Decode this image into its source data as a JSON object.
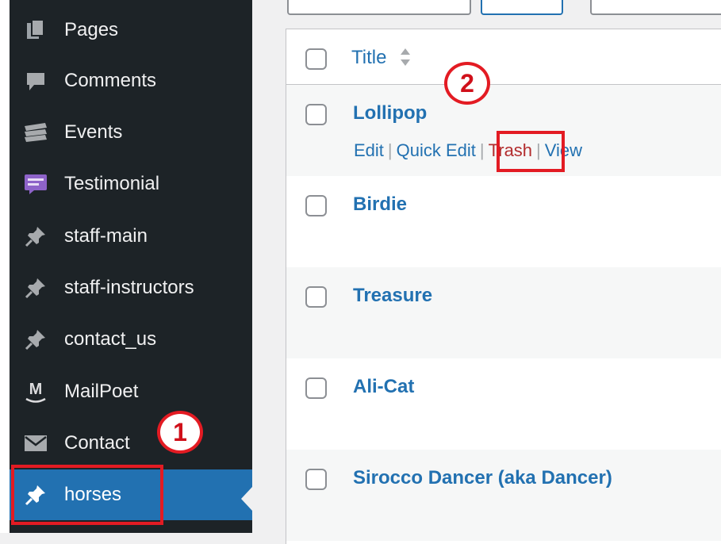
{
  "sidebar": {
    "items": [
      {
        "label": "Pages",
        "icon": "pages-icon"
      },
      {
        "label": "Comments",
        "icon": "comments-icon"
      },
      {
        "label": "Events",
        "icon": "events-icon"
      },
      {
        "label": "Testimonial",
        "icon": "testimonial-icon"
      },
      {
        "label": "staff-main",
        "icon": "pin-icon"
      },
      {
        "label": "staff-instructors",
        "icon": "pin-icon"
      },
      {
        "label": "contact_us",
        "icon": "pin-icon"
      },
      {
        "label": "MailPoet",
        "icon": "mailpoet-icon"
      },
      {
        "label": "Contact",
        "icon": "envelope-icon"
      },
      {
        "label": "horses",
        "icon": "pin-icon",
        "active": true
      }
    ],
    "mailpoet_icon_letter": "M"
  },
  "table": {
    "column_title": "Title",
    "rows": [
      {
        "title": "Lollipop",
        "actions": {
          "edit": "Edit",
          "quick_edit": "Quick Edit",
          "trash": "Trash",
          "view": "View"
        }
      },
      {
        "title": "Birdie"
      },
      {
        "title": "Treasure"
      },
      {
        "title": "Ali-Cat"
      },
      {
        "title": "Sirocco Dancer (aka Dancer)"
      }
    ]
  },
  "annotations": {
    "badge_1": "1",
    "badge_2": "2",
    "color": "#e31b23"
  },
  "colors": {
    "sidebar_bg": "#1d2327",
    "active_bg": "#2271b1",
    "link": "#2271b1",
    "trash": "#b32d2e"
  }
}
